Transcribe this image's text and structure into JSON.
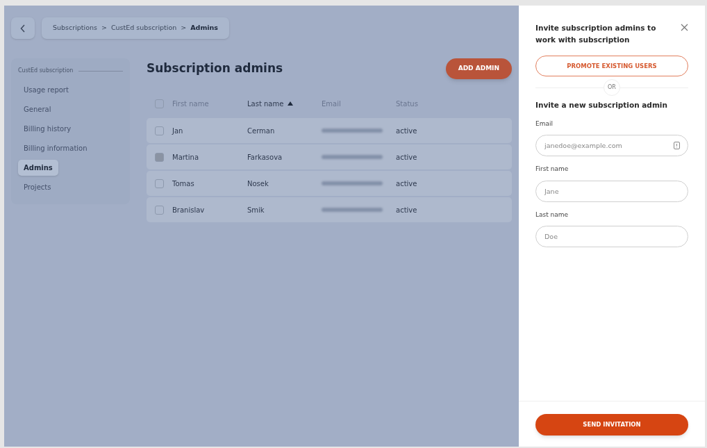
{
  "breadcrumb": {
    "items": [
      {
        "label": "Subscriptions",
        "current": false
      },
      {
        "label": "CustEd subscription",
        "current": false
      },
      {
        "label": "Admins",
        "current": true
      }
    ],
    "separator": ">"
  },
  "sidebar": {
    "title": "CustEd subscription",
    "items": [
      {
        "label": "Usage report",
        "selected": false
      },
      {
        "label": "General",
        "selected": false
      },
      {
        "label": "Billing history",
        "selected": false
      },
      {
        "label": "Billing information",
        "selected": false
      },
      {
        "label": "Admins",
        "selected": true
      },
      {
        "label": "Projects",
        "selected": false
      }
    ]
  },
  "page": {
    "title": "Subscription admins",
    "add_button": "ADD ADMIN"
  },
  "table": {
    "select_all_checked": false,
    "columns": [
      {
        "label": "First name",
        "sorted": false
      },
      {
        "label": "Last name",
        "sorted": true
      },
      {
        "label": "Email",
        "sorted": false
      },
      {
        "label": "Status",
        "sorted": false
      }
    ],
    "rows": [
      {
        "first_name": "Jan",
        "last_name": "Cerman",
        "status": "active",
        "checked": false
      },
      {
        "first_name": "Martina",
        "last_name": "Farkasova",
        "status": "active",
        "checked": true
      },
      {
        "first_name": "Tomas",
        "last_name": "Nosek",
        "status": "active",
        "checked": false
      },
      {
        "first_name": "Branislav",
        "last_name": "Smik",
        "status": "active",
        "checked": false
      }
    ]
  },
  "drawer": {
    "title": "Invite subscription admins to work with subscription",
    "promote_button": "PROMOTE EXISTING USERS",
    "divider_text": "OR",
    "subtitle": "Invite a new subscription admin",
    "fields": [
      {
        "label": "Email",
        "placeholder": "janedoe@example.com",
        "kind": "email"
      },
      {
        "label": "First name",
        "placeholder": "Jane",
        "kind": "text"
      },
      {
        "label": "Last name",
        "placeholder": "Doe",
        "kind": "text"
      }
    ],
    "submit_button": "SEND INVITATION"
  }
}
